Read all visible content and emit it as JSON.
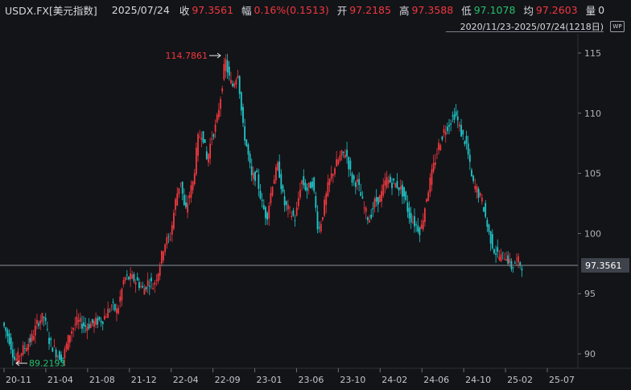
{
  "header": {
    "symbol": "USDX.FX[美元指数]",
    "date": "2025/07/24",
    "close_label": "收",
    "close_value": "97.3561",
    "change_label": "幅",
    "change_value": "0.16%(0.1513)",
    "open_label": "开",
    "open_value": "97.2185",
    "high_label": "高",
    "high_value": "97.3588",
    "low_label": "低",
    "low_value": "97.1078",
    "avg_label": "均",
    "avg_value": "97.2603",
    "volume_label": "量",
    "volume_value": "0"
  },
  "range_label": "2020/11/23-2025/07/24(1218日)",
  "settings_icon": "chart-settings-icon",
  "chart_data": {
    "type": "candlestick",
    "x_labels": [
      "20-11",
      "21-04",
      "21-08",
      "21-12",
      "22-04",
      "22-09",
      "23-01",
      "23-06",
      "23-10",
      "24-02",
      "24-06",
      "24-10",
      "25-02",
      "25-07"
    ],
    "y_ticks": [
      90,
      95,
      100,
      105,
      110,
      115
    ],
    "ylim": [
      88.8,
      116.6
    ],
    "max_annotation": "114.7861",
    "min_annotation": "89.2193",
    "current_price": "97.3561",
    "colors": {
      "up": "#f0383f",
      "down": "#1fc6c9",
      "current_line": "#8a8f98"
    },
    "path": [
      {
        "x": 0.0,
        "y": 92.6
      },
      {
        "x": 0.012,
        "y": 91.2
      },
      {
        "x": 0.022,
        "y": 89.4
      },
      {
        "x": 0.035,
        "y": 90.3
      },
      {
        "x": 0.05,
        "y": 91.2
      },
      {
        "x": 0.062,
        "y": 92.7
      },
      {
        "x": 0.072,
        "y": 93.1
      },
      {
        "x": 0.082,
        "y": 91.0
      },
      {
        "x": 0.095,
        "y": 90.0
      },
      {
        "x": 0.105,
        "y": 89.6
      },
      {
        "x": 0.118,
        "y": 91.8
      },
      {
        "x": 0.13,
        "y": 92.7
      },
      {
        "x": 0.145,
        "y": 92.3
      },
      {
        "x": 0.16,
        "y": 92.6
      },
      {
        "x": 0.175,
        "y": 92.9
      },
      {
        "x": 0.19,
        "y": 94.0
      },
      {
        "x": 0.2,
        "y": 93.5
      },
      {
        "x": 0.212,
        "y": 96.3
      },
      {
        "x": 0.225,
        "y": 96.3
      },
      {
        "x": 0.235,
        "y": 96.0
      },
      {
        "x": 0.245,
        "y": 95.3
      },
      {
        "x": 0.255,
        "y": 96.1
      },
      {
        "x": 0.262,
        "y": 95.6
      },
      {
        "x": 0.272,
        "y": 97.0
      },
      {
        "x": 0.282,
        "y": 99.2
      },
      {
        "x": 0.292,
        "y": 99.7
      },
      {
        "x": 0.302,
        "y": 102.9
      },
      {
        "x": 0.31,
        "y": 104.5
      },
      {
        "x": 0.318,
        "y": 101.6
      },
      {
        "x": 0.325,
        "y": 103.2
      },
      {
        "x": 0.332,
        "y": 104.3
      },
      {
        "x": 0.34,
        "y": 107.8
      },
      {
        "x": 0.348,
        "y": 108.5
      },
      {
        "x": 0.356,
        "y": 106.0
      },
      {
        "x": 0.364,
        "y": 108.0
      },
      {
        "x": 0.372,
        "y": 109.0
      },
      {
        "x": 0.38,
        "y": 111.5
      },
      {
        "x": 0.388,
        "y": 114.5
      },
      {
        "x": 0.394,
        "y": 113.0
      },
      {
        "x": 0.4,
        "y": 112.2
      },
      {
        "x": 0.41,
        "y": 113.5
      },
      {
        "x": 0.418,
        "y": 109.0
      },
      {
        "x": 0.426,
        "y": 107.0
      },
      {
        "x": 0.434,
        "y": 104.6
      },
      {
        "x": 0.442,
        "y": 104.9
      },
      {
        "x": 0.452,
        "y": 102.4
      },
      {
        "x": 0.46,
        "y": 101.3
      },
      {
        "x": 0.47,
        "y": 104.2
      },
      {
        "x": 0.48,
        "y": 105.7
      },
      {
        "x": 0.49,
        "y": 102.5
      },
      {
        "x": 0.5,
        "y": 101.8
      },
      {
        "x": 0.51,
        "y": 101.2
      },
      {
        "x": 0.52,
        "y": 104.5
      },
      {
        "x": 0.53,
        "y": 103.6
      },
      {
        "x": 0.54,
        "y": 104.3
      },
      {
        "x": 0.55,
        "y": 100.1
      },
      {
        "x": 0.558,
        "y": 101.8
      },
      {
        "x": 0.568,
        "y": 104.2
      },
      {
        "x": 0.578,
        "y": 105.5
      },
      {
        "x": 0.588,
        "y": 106.4
      },
      {
        "x": 0.598,
        "y": 106.8
      },
      {
        "x": 0.608,
        "y": 104.5
      },
      {
        "x": 0.618,
        "y": 104.2
      },
      {
        "x": 0.628,
        "y": 102.3
      },
      {
        "x": 0.638,
        "y": 101.1
      },
      {
        "x": 0.648,
        "y": 102.6
      },
      {
        "x": 0.658,
        "y": 103.0
      },
      {
        "x": 0.668,
        "y": 104.5
      },
      {
        "x": 0.678,
        "y": 104.2
      },
      {
        "x": 0.688,
        "y": 104.0
      },
      {
        "x": 0.698,
        "y": 103.3
      },
      {
        "x": 0.708,
        "y": 101.5
      },
      {
        "x": 0.718,
        "y": 100.8
      },
      {
        "x": 0.728,
        "y": 100.2
      },
      {
        "x": 0.738,
        "y": 103.0
      },
      {
        "x": 0.748,
        "y": 105.1
      },
      {
        "x": 0.758,
        "y": 107.1
      },
      {
        "x": 0.768,
        "y": 108.5
      },
      {
        "x": 0.778,
        "y": 109.2
      },
      {
        "x": 0.788,
        "y": 110.0
      },
      {
        "x": 0.798,
        "y": 108.4
      },
      {
        "x": 0.808,
        "y": 107.3
      },
      {
        "x": 0.818,
        "y": 104.2
      },
      {
        "x": 0.826,
        "y": 103.6
      },
      {
        "x": 0.836,
        "y": 102.5
      },
      {
        "x": 0.846,
        "y": 100.1
      },
      {
        "x": 0.856,
        "y": 98.6
      },
      {
        "x": 0.866,
        "y": 98.0
      },
      {
        "x": 0.876,
        "y": 98.2
      },
      {
        "x": 0.886,
        "y": 97.2
      },
      {
        "x": 0.896,
        "y": 97.8
      },
      {
        "x": 0.904,
        "y": 97.36
      }
    ]
  }
}
